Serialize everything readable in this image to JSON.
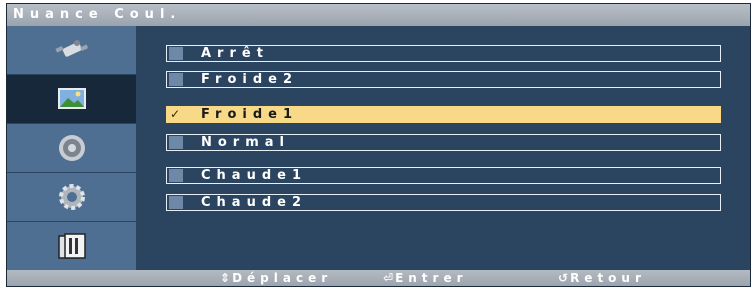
{
  "title": "Nuance Coul.",
  "sidebar": {
    "items": [
      {
        "icon": "satellite-icon",
        "active": false
      },
      {
        "icon": "picture-icon",
        "active": true
      },
      {
        "icon": "speaker-icon",
        "active": false
      },
      {
        "icon": "gear-icon",
        "active": false
      },
      {
        "icon": "multi-window-icon",
        "active": false
      }
    ]
  },
  "options": [
    {
      "label": "Arrêt",
      "selected": false
    },
    {
      "label": "Froide2",
      "selected": false
    },
    {
      "label": "Froide1",
      "selected": true
    },
    {
      "label": "Normal",
      "selected": false
    },
    {
      "label": "Chaude1",
      "selected": false
    },
    {
      "label": "Chaude2",
      "selected": false
    }
  ],
  "footer": {
    "move_icon": "⇕",
    "move_label": "Déplacer",
    "enter_icon": "⏎",
    "enter_label": "Entrer",
    "return_icon": "↺",
    "return_label": "Retour"
  },
  "colors": {
    "background": "#2b4560",
    "sidebar": "#4f6f92",
    "selection": "#f8d987"
  }
}
